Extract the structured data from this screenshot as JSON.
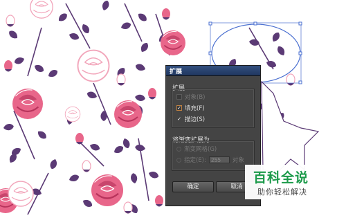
{
  "dialog": {
    "title": "扩展",
    "expand_group": {
      "label": "扩展",
      "options": [
        {
          "label": "对象(B)",
          "checked": false,
          "enabled": false
        },
        {
          "label": "填充(F)",
          "checked": true,
          "enabled": true
        },
        {
          "label": "描边(S)",
          "checked": true,
          "enabled": true
        }
      ]
    },
    "gradient_group": {
      "label": "将渐变扩展为",
      "gradient_mesh": {
        "label": "渐变网格(G)",
        "enabled": false
      },
      "specify": {
        "label": "指定(E):",
        "value": "255",
        "suffix": "对象",
        "enabled": false
      }
    },
    "ok_label": "确定",
    "cancel_label": "取消"
  },
  "watermark": {
    "title": "百科全说",
    "subtitle": "助你轻松解决"
  },
  "colors": {
    "rose_pink": "#e8668a",
    "rose_outline": "#f2a6bb",
    "leaf_purple": "#5b3a75",
    "dialog_bg": "#444444",
    "titlebar": "#2a4575",
    "selection": "#4a6fd0",
    "watermark_green": "#1c9a4a"
  }
}
